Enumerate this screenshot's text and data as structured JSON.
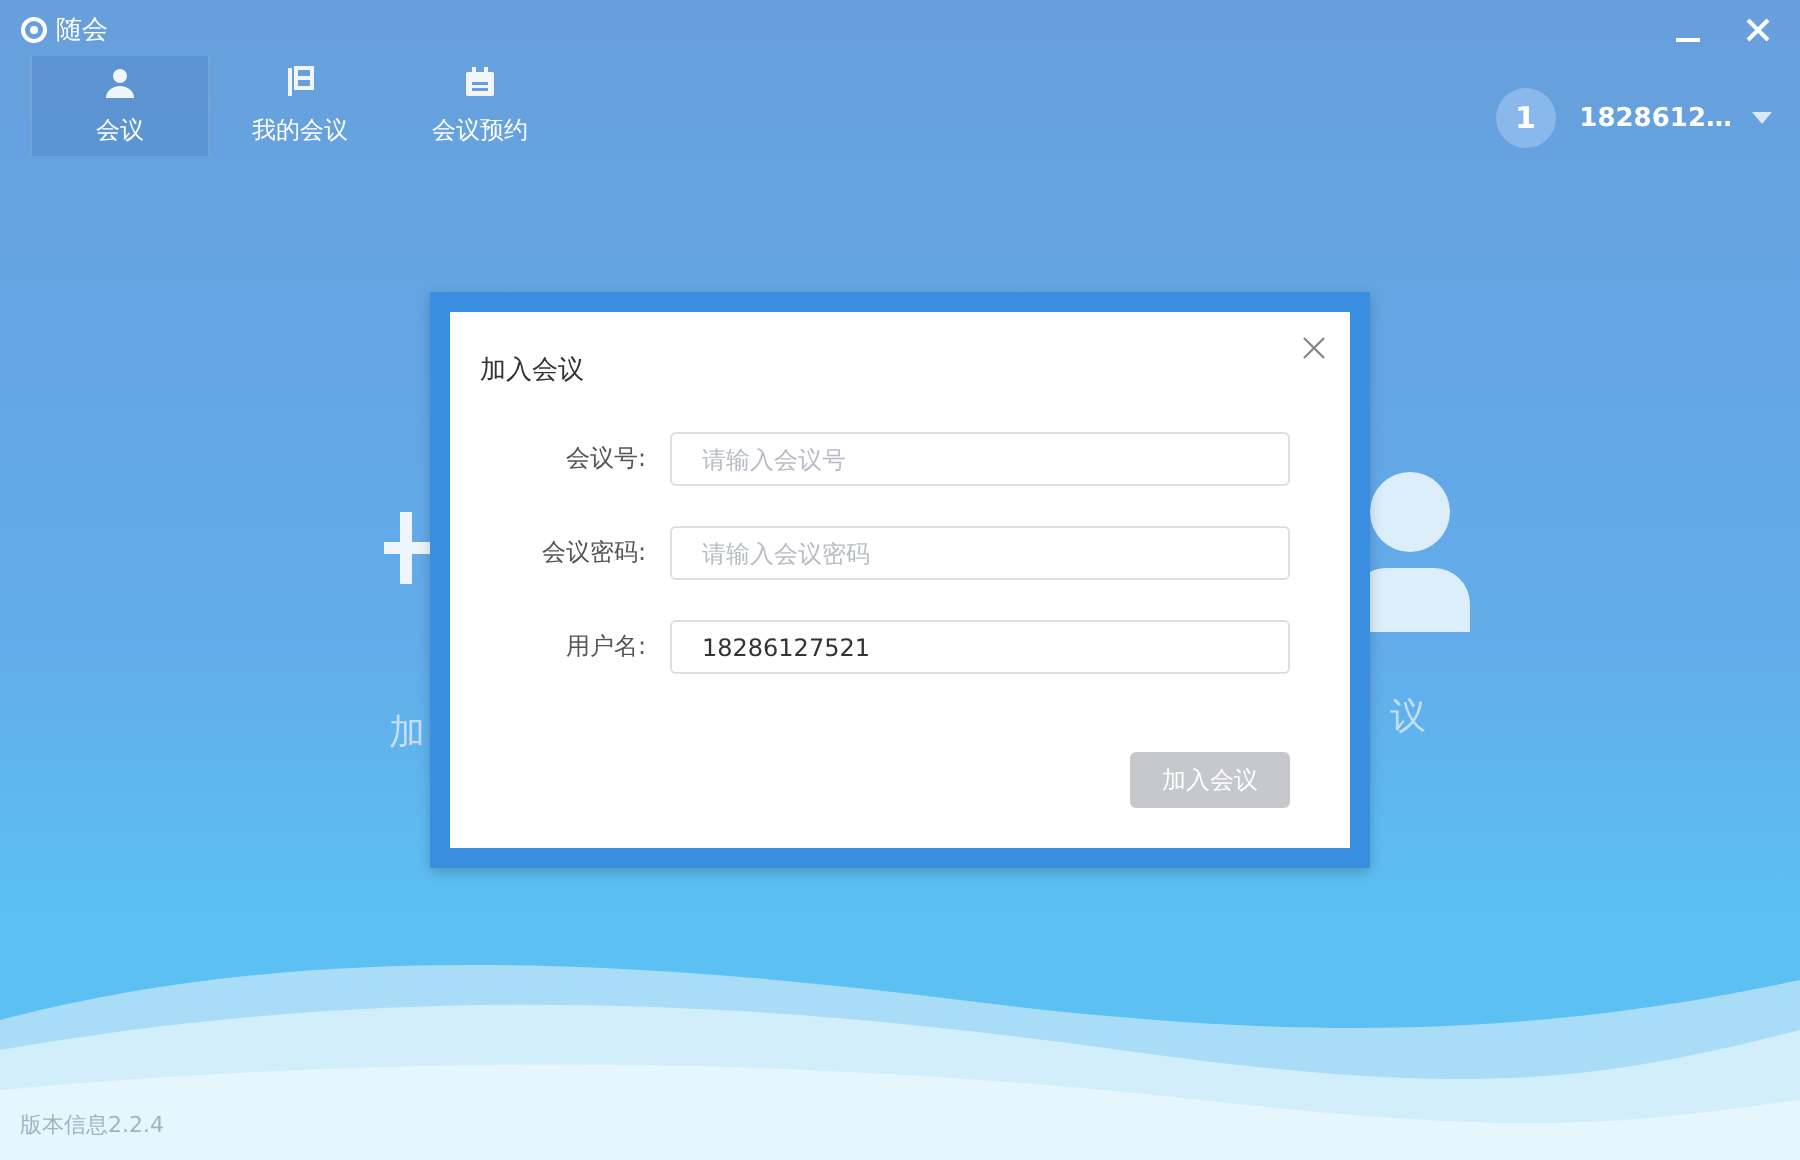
{
  "app": {
    "title": "随会"
  },
  "tabs": [
    {
      "label": "会议",
      "kind": "person",
      "selected": true
    },
    {
      "label": "我的会议",
      "kind": "list",
      "selected": false
    },
    {
      "label": "会议预约",
      "kind": "calendar",
      "selected": false
    }
  ],
  "user": {
    "avatar": "1",
    "name": "1828612…"
  },
  "background_cards": [
    {
      "kind": "plus",
      "label_fragment": "加"
    },
    {
      "kind": "person",
      "label_fragment": "议"
    }
  ],
  "dialog": {
    "title": "加入会议",
    "fields": [
      {
        "label": "会议号:",
        "placeholder": "请输入会议号"
      },
      {
        "label": "会议密码:",
        "placeholder": "请输入会议密码"
      },
      {
        "label": "用户名:",
        "value": "18286127521"
      }
    ],
    "button": {
      "label": "加入会议",
      "disabled": true
    }
  },
  "version": "版本信息2.2.4"
}
